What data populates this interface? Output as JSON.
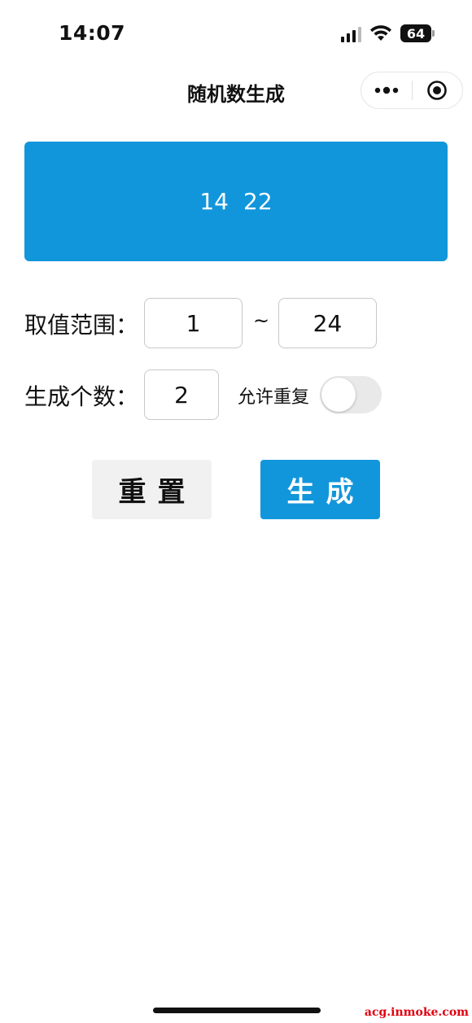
{
  "status_bar": {
    "time": "14:07",
    "battery": "64"
  },
  "nav": {
    "title": "随机数生成",
    "more_icon": "more-dots-icon",
    "close_icon": "target-circle-icon"
  },
  "result": {
    "numbers": [
      "14",
      "22"
    ]
  },
  "range": {
    "label": "取值范围：",
    "min": "1",
    "separator": "~",
    "max": "24"
  },
  "count": {
    "label": "生成个数：",
    "value": "2",
    "allow_repeat_label": "允许重复",
    "allow_repeat": false
  },
  "buttons": {
    "reset": "重置",
    "generate": "生成"
  },
  "watermark": "acg.inmoke.com",
  "colors": {
    "accent": "#1296db",
    "reset_bg": "#f1f1f1",
    "toggle_off": "#e9e9e9"
  }
}
